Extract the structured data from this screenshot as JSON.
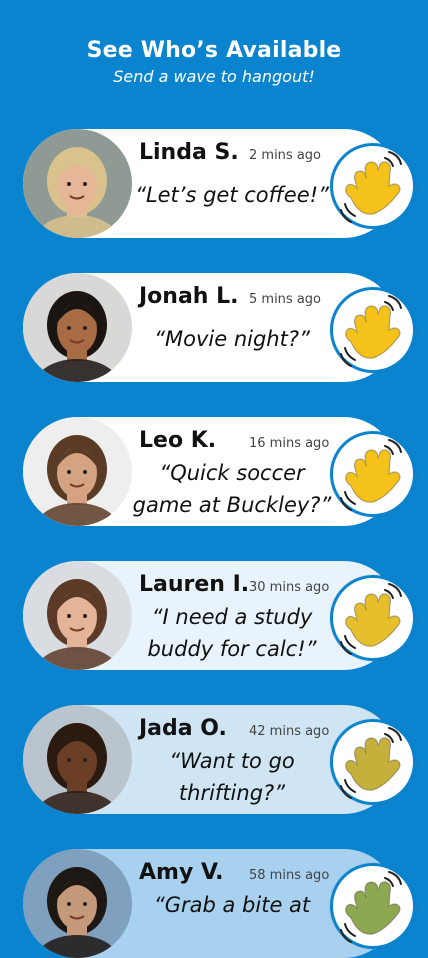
{
  "header": {
    "title": "See Who’s Available",
    "subtitle": "Send a wave to hangout!"
  },
  "cards": [
    {
      "name": "Linda S.",
      "time": "2 mins ago",
      "message": "“Let’s get coffee!”",
      "bg": "#ffffff",
      "wave_color": "#f5c21b",
      "avatar_skin": "#e6b796",
      "avatar_hair": "#d9c28c",
      "avatar_bg": "#8f9a95"
    },
    {
      "name": "Jonah L.",
      "time": "5 mins ago",
      "message": "“Movie night?”",
      "bg": "#ffffff",
      "wave_color": "#f5c21b",
      "avatar_skin": "#a86c45",
      "avatar_hair": "#1b1512",
      "avatar_bg": "#d8d8d6"
    },
    {
      "name": "Leo K.",
      "time": "16 mins ago",
      "message": "“Quick soccer game at Buckley?”",
      "bg": "#ffffff",
      "wave_color": "#f5c21b",
      "avatar_skin": "#d5a382",
      "avatar_hair": "#5a3b26",
      "avatar_bg": "#eeeeee"
    },
    {
      "name": "Lauren I.",
      "time": "30 mins ago",
      "message": "“I need a study buddy for calc!”",
      "bg": "#e9f3fb",
      "wave_color": "#e7bf2c",
      "avatar_skin": "#e3b497",
      "avatar_hair": "#5b3a28",
      "avatar_bg": "#d9dce0"
    },
    {
      "name": "Jada O.",
      "time": "42 mins ago",
      "message": "“Want to go thrifting?”",
      "bg": "#cfe5f4",
      "wave_color": "#c6b03c",
      "avatar_skin": "#6b3f26",
      "avatar_hair": "#2a1a10",
      "avatar_bg": "#b9c4cc"
    },
    {
      "name": "Amy V.",
      "time": "58 mins ago",
      "message": "“Grab a bite at",
      "bg": "#a7d1ef",
      "wave_color": "#8ea852",
      "avatar_skin": "#c49a7a",
      "avatar_hair": "#1d1814",
      "avatar_bg": "#7fa0bf"
    }
  ]
}
